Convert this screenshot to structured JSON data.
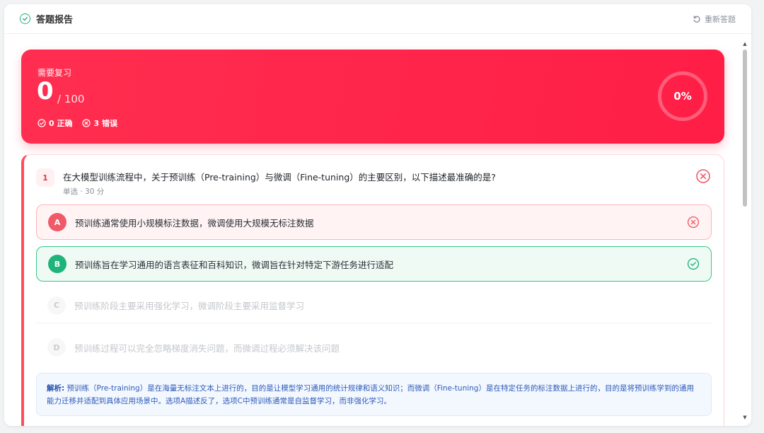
{
  "header": {
    "title": "答题报告",
    "redo_label": "重新答题"
  },
  "score": {
    "status_label": "需要复习",
    "value": "0",
    "total": "/ 100",
    "correct_label": "0 正确",
    "wrong_label": "3 错误",
    "percent": "0%"
  },
  "question": {
    "index": "1",
    "text": "在大模型训练流程中，关于预训练（Pre-training）与微调（Fine-tuning）的主要区别，以下描述最准确的是?",
    "meta": "单选 · 30 分",
    "options": [
      {
        "letter": "A",
        "text": "预训练通常使用小规模标注数据，微调使用大规模无标注数据",
        "state": "wrong"
      },
      {
        "letter": "B",
        "text": "预训练旨在学习通用的语言表征和百科知识，微调旨在针对特定下游任务进行适配",
        "state": "correct"
      },
      {
        "letter": "C",
        "text": "预训练阶段主要采用强化学习，微调阶段主要采用监督学习",
        "state": "neutral"
      },
      {
        "letter": "D",
        "text": "预训练过程可以完全忽略梯度消失问题，而微调过程必须解决该问题",
        "state": "neutral"
      }
    ],
    "explanation_label": "解析:",
    "explanation": "预训练（Pre-training）是在海量无标注文本上进行的，目的是让模型学习通用的统计规律和语义知识；而微调（Fine-tuning）是在特定任务的标注数据上进行的，目的是将预训练学到的通用能力迁移并适配到具体应用场景中。选项A描述反了，选项C中预训练通常是自监督学习，而非强化学习。"
  },
  "colors": {
    "accent_red": "#ff2e50",
    "correct_green": "#1fb57a",
    "wrong_red": "#f05a68",
    "explain_blue": "#2e5bb8"
  }
}
